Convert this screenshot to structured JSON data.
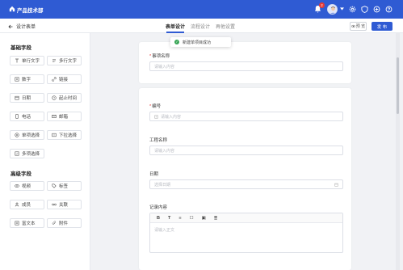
{
  "topbar": {
    "title": "产品技术部",
    "notification_count": "2",
    "colors": {
      "bg": "#2f5bd3",
      "badge": "#e53935"
    }
  },
  "subbar": {
    "back_label": "设计表单",
    "tabs": [
      {
        "label": "表单设计",
        "active": true
      },
      {
        "label": "流程设计",
        "active": false
      },
      {
        "label": "再他设置",
        "active": false
      }
    ],
    "preview_label": "预 览",
    "publish_label": "发 布"
  },
  "toast": {
    "message": "新建单项目成功"
  },
  "sidebar": {
    "basic_title": "基础字段",
    "basic_fields": [
      {
        "label": "单行文字",
        "icon": "text-icon"
      },
      {
        "label": "多行文字",
        "icon": "multiline-icon"
      },
      {
        "label": "数字",
        "icon": "number-icon"
      },
      {
        "label": "链接",
        "icon": "link-icon"
      },
      {
        "label": "日期",
        "icon": "calendar-icon"
      },
      {
        "label": "起止时间",
        "icon": "clock-icon"
      },
      {
        "label": "电话",
        "icon": "phone-icon"
      },
      {
        "label": "邮箱",
        "icon": "mail-icon"
      },
      {
        "label": "单项选择",
        "icon": "radio-icon"
      },
      {
        "label": "下拉选择",
        "icon": "dropdown-icon"
      },
      {
        "label": "多项选择",
        "icon": "checkbox-icon"
      }
    ],
    "advanced_title": "高级字段",
    "advanced_fields": [
      {
        "label": "视频",
        "icon": "video-icon"
      },
      {
        "label": "标签",
        "icon": "tag-icon"
      },
      {
        "label": "成员",
        "icon": "user-icon"
      },
      {
        "label": "关联",
        "icon": "relation-icon"
      },
      {
        "label": "富文本",
        "icon": "richtext-icon"
      },
      {
        "label": "附件",
        "icon": "paperclip-icon"
      }
    ]
  },
  "form": {
    "project_name": {
      "label": "事项名称",
      "required": true,
      "placeholder": "请输入内容"
    },
    "number": {
      "label": "编号",
      "required": true,
      "placeholder": "请输入内容"
    },
    "project_title": {
      "label": "工程名称",
      "placeholder": "请输入内容"
    },
    "date": {
      "label": "日期",
      "placeholder": "选择日期"
    },
    "record": {
      "label": "记录内容",
      "placeholder": "请输入正文",
      "toolbar": [
        "B",
        "T",
        "≡",
        "☐",
        "▣",
        "≣"
      ]
    }
  }
}
